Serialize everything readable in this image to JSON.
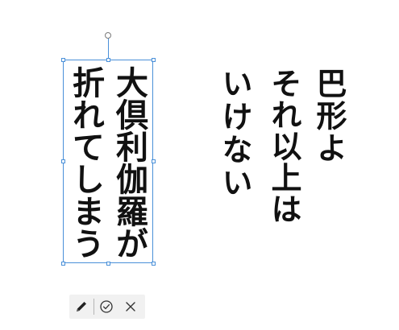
{
  "canvas": {
    "text_block_right": {
      "lines": [
        "巴形よ",
        "それ以上は",
        "いけない"
      ]
    },
    "text_block_selected": {
      "lines": [
        "大倶利伽羅が",
        "折れてしまう"
      ]
    }
  },
  "selection": {
    "border_color": "#4a90d9"
  },
  "toolbar": {
    "buttons": [
      {
        "icon": "pencil-icon",
        "action": "edit"
      },
      {
        "icon": "check-circle-icon",
        "action": "confirm"
      },
      {
        "icon": "close-icon",
        "action": "cancel"
      }
    ]
  }
}
